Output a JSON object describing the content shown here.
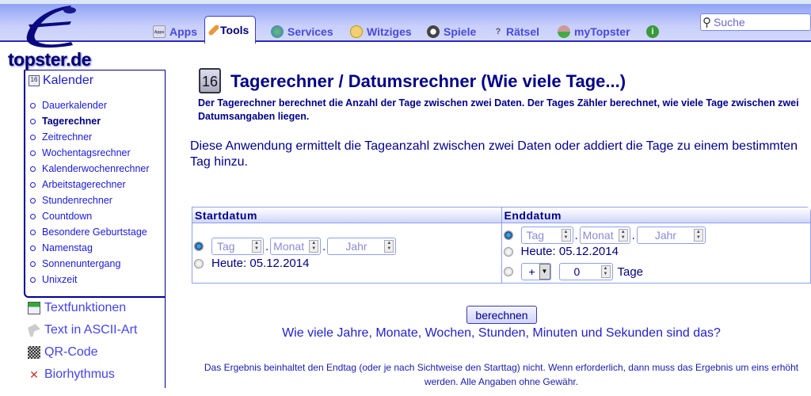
{
  "site": {
    "logo_text": "topster.de"
  },
  "nav": {
    "tabs": [
      {
        "label": "Apps",
        "icon": "apps-icon"
      },
      {
        "label": "Tools",
        "icon": "wrench-icon",
        "active": true
      },
      {
        "label": "Services",
        "icon": "globe-icon"
      },
      {
        "label": "Witziges",
        "icon": "smiley-icon"
      },
      {
        "label": "Spiele",
        "icon": "soccer-ball-icon"
      },
      {
        "label": "Rätsel",
        "icon": "question-icon"
      },
      {
        "label": "myTopster",
        "icon": "user-icon"
      }
    ],
    "info_icon": "info-icon"
  },
  "search": {
    "placeholder": "Suche"
  },
  "sidebar": {
    "section": "Kalender",
    "items": [
      "Dauerkalender",
      "Tagerechner",
      "Zeitrechner",
      "Wochentagsrechner",
      "Kalenderwochenrechner",
      "Arbeitstagerechner",
      "Stundenrechner",
      "Countdown",
      "Besondere Geburtstage",
      "Namenstag",
      "Sonnenuntergang",
      "Unixzeit"
    ],
    "current": "Tagerechner",
    "tools": [
      "Textfunktionen",
      "Text in ASCII-Art",
      "QR-Code",
      "Biorhythmus"
    ]
  },
  "main": {
    "title": "Tagerechner / Datumsrechner (Wie viele Tage...)",
    "subtitle": "Der Tagerechner berechnet die Anzahl der Tage zwischen zwei Daten. Der Tages Zähler berechnet, wie viele Tage zwischen zwei Datumsangaben liegen.",
    "intro": "Diese Anwendung ermittelt die Tageanzahl zwischen zwei Daten oder addiert die Tage zu einem bestimmten Tag hinzu.",
    "start": {
      "header": "Startdatum",
      "day": "Tag",
      "month": "Monat",
      "year": "Jahr",
      "today": "Heute: 05.12.2014"
    },
    "end": {
      "header": "Enddatum",
      "day": "Tag",
      "month": "Monat",
      "year": "Jahr",
      "today": "Heute: 05.12.2014",
      "op": "+",
      "days_value": "0",
      "days_label": "Tage"
    },
    "sep": ".",
    "button": "berechnen",
    "more_link": "Wie viele Jahre, Monate, Wochen, Stunden, Minuten und Sekunden sind das?",
    "note": "Das Ergebnis beinhaltet den Endtag (oder je nach Sichtweise den Starttag) nicht. Wenn erforderlich, dann muss das Ergebnis um eins erhöht werden. Alle Angaben ohne Gewähr."
  },
  "colors": {
    "navy": "#000080",
    "link": "#1a1add",
    "nav_bg": "#c8cffb"
  }
}
